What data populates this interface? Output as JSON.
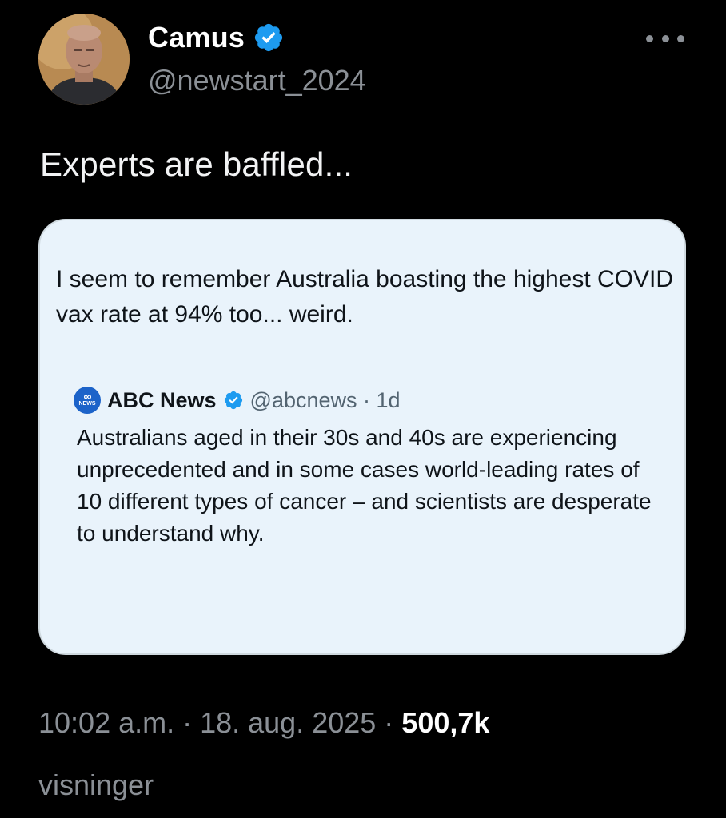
{
  "author": {
    "display_name": "Camus",
    "handle": "@newstart_2024",
    "verified": true,
    "avatar": "avatar-photo"
  },
  "tweet": {
    "text": "Experts are baffled..."
  },
  "quote": {
    "text": "I seem to remember Australia boasting the highest COVID vax rate at 94% too... weird.",
    "embedded": {
      "source_name": "ABC News",
      "handle_time": "@abcnews · 1d",
      "verified": true,
      "logo": "abc-news-logo",
      "body": "Australians aged in their 30s and 40s are experiencing unprecedented and in some cases world-leading rates of 10 different types of cancer – and scientists are desperate to understand why."
    }
  },
  "meta": {
    "timestamp": "10:02 a.m. · 18. aug. 2025 · ",
    "views_count": "500,7k",
    "views_label": "visninger"
  },
  "colors": {
    "background": "#000000",
    "card_background": "#e9f3fb",
    "verified_blue": "#1d9bf0",
    "secondary_text": "#8b9096"
  },
  "icons": {
    "more": "more-horizontal-icon",
    "verified": "verified-badge-icon"
  }
}
